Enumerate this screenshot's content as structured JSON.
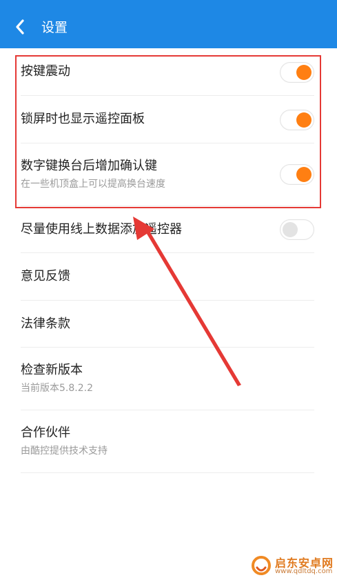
{
  "header": {
    "title": "设置",
    "back_icon": "chevron-left-icon",
    "background": "#1e88e5"
  },
  "settings": {
    "items": [
      {
        "title": "按键震动",
        "subtitle": "",
        "toggle": true
      },
      {
        "title": "锁屏时也显示遥控面板",
        "subtitle": "",
        "toggle": true
      },
      {
        "title": "数字键换台后增加确认键",
        "subtitle": "在一些机顶盒上可以提高换台速度",
        "toggle": true
      },
      {
        "title": "尽量使用线上数据添加遥控器",
        "subtitle": "",
        "toggle": false
      },
      {
        "title": "意见反馈",
        "subtitle": ""
      },
      {
        "title": "法律条款",
        "subtitle": ""
      },
      {
        "title": "检查新版本",
        "subtitle": "当前版本5.8.2.2"
      },
      {
        "title": "合作伙伴",
        "subtitle": "由酷控提供技术支持"
      }
    ]
  },
  "colors": {
    "toggle_on": "#ff7f12",
    "toggle_off": "#e3e3e3",
    "annotation": "#e53935"
  },
  "watermark": {
    "name": "启东安卓网",
    "url": "www.qdltdq.com"
  }
}
